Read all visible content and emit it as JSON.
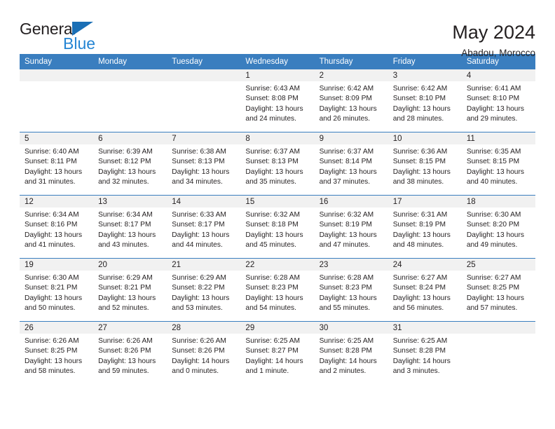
{
  "brand": {
    "name_part1": "General",
    "name_part2": "Blue",
    "accent_color": "#2585d3",
    "triangle_color": "#1b6fb5"
  },
  "header": {
    "title": "May 2024",
    "subtitle": "Abadou, Morocco"
  },
  "calendar": {
    "header_bg": "#3a7ebf",
    "daynum_bg": "#f1f1f1",
    "weekday_headers": [
      "Sunday",
      "Monday",
      "Tuesday",
      "Wednesday",
      "Thursday",
      "Friday",
      "Saturday"
    ],
    "weeks": [
      [
        {
          "day": "",
          "sunrise": "",
          "sunset": "",
          "daylight1": "",
          "daylight2": ""
        },
        {
          "day": "",
          "sunrise": "",
          "sunset": "",
          "daylight1": "",
          "daylight2": ""
        },
        {
          "day": "",
          "sunrise": "",
          "sunset": "",
          "daylight1": "",
          "daylight2": ""
        },
        {
          "day": "1",
          "sunrise": "Sunrise: 6:43 AM",
          "sunset": "Sunset: 8:08 PM",
          "daylight1": "Daylight: 13 hours",
          "daylight2": "and 24 minutes."
        },
        {
          "day": "2",
          "sunrise": "Sunrise: 6:42 AM",
          "sunset": "Sunset: 8:09 PM",
          "daylight1": "Daylight: 13 hours",
          "daylight2": "and 26 minutes."
        },
        {
          "day": "3",
          "sunrise": "Sunrise: 6:42 AM",
          "sunset": "Sunset: 8:10 PM",
          "daylight1": "Daylight: 13 hours",
          "daylight2": "and 28 minutes."
        },
        {
          "day": "4",
          "sunrise": "Sunrise: 6:41 AM",
          "sunset": "Sunset: 8:10 PM",
          "daylight1": "Daylight: 13 hours",
          "daylight2": "and 29 minutes."
        }
      ],
      [
        {
          "day": "5",
          "sunrise": "Sunrise: 6:40 AM",
          "sunset": "Sunset: 8:11 PM",
          "daylight1": "Daylight: 13 hours",
          "daylight2": "and 31 minutes."
        },
        {
          "day": "6",
          "sunrise": "Sunrise: 6:39 AM",
          "sunset": "Sunset: 8:12 PM",
          "daylight1": "Daylight: 13 hours",
          "daylight2": "and 32 minutes."
        },
        {
          "day": "7",
          "sunrise": "Sunrise: 6:38 AM",
          "sunset": "Sunset: 8:13 PM",
          "daylight1": "Daylight: 13 hours",
          "daylight2": "and 34 minutes."
        },
        {
          "day": "8",
          "sunrise": "Sunrise: 6:37 AM",
          "sunset": "Sunset: 8:13 PM",
          "daylight1": "Daylight: 13 hours",
          "daylight2": "and 35 minutes."
        },
        {
          "day": "9",
          "sunrise": "Sunrise: 6:37 AM",
          "sunset": "Sunset: 8:14 PM",
          "daylight1": "Daylight: 13 hours",
          "daylight2": "and 37 minutes."
        },
        {
          "day": "10",
          "sunrise": "Sunrise: 6:36 AM",
          "sunset": "Sunset: 8:15 PM",
          "daylight1": "Daylight: 13 hours",
          "daylight2": "and 38 minutes."
        },
        {
          "day": "11",
          "sunrise": "Sunrise: 6:35 AM",
          "sunset": "Sunset: 8:15 PM",
          "daylight1": "Daylight: 13 hours",
          "daylight2": "and 40 minutes."
        }
      ],
      [
        {
          "day": "12",
          "sunrise": "Sunrise: 6:34 AM",
          "sunset": "Sunset: 8:16 PM",
          "daylight1": "Daylight: 13 hours",
          "daylight2": "and 41 minutes."
        },
        {
          "day": "13",
          "sunrise": "Sunrise: 6:34 AM",
          "sunset": "Sunset: 8:17 PM",
          "daylight1": "Daylight: 13 hours",
          "daylight2": "and 43 minutes."
        },
        {
          "day": "14",
          "sunrise": "Sunrise: 6:33 AM",
          "sunset": "Sunset: 8:17 PM",
          "daylight1": "Daylight: 13 hours",
          "daylight2": "and 44 minutes."
        },
        {
          "day": "15",
          "sunrise": "Sunrise: 6:32 AM",
          "sunset": "Sunset: 8:18 PM",
          "daylight1": "Daylight: 13 hours",
          "daylight2": "and 45 minutes."
        },
        {
          "day": "16",
          "sunrise": "Sunrise: 6:32 AM",
          "sunset": "Sunset: 8:19 PM",
          "daylight1": "Daylight: 13 hours",
          "daylight2": "and 47 minutes."
        },
        {
          "day": "17",
          "sunrise": "Sunrise: 6:31 AM",
          "sunset": "Sunset: 8:19 PM",
          "daylight1": "Daylight: 13 hours",
          "daylight2": "and 48 minutes."
        },
        {
          "day": "18",
          "sunrise": "Sunrise: 6:30 AM",
          "sunset": "Sunset: 8:20 PM",
          "daylight1": "Daylight: 13 hours",
          "daylight2": "and 49 minutes."
        }
      ],
      [
        {
          "day": "19",
          "sunrise": "Sunrise: 6:30 AM",
          "sunset": "Sunset: 8:21 PM",
          "daylight1": "Daylight: 13 hours",
          "daylight2": "and 50 minutes."
        },
        {
          "day": "20",
          "sunrise": "Sunrise: 6:29 AM",
          "sunset": "Sunset: 8:21 PM",
          "daylight1": "Daylight: 13 hours",
          "daylight2": "and 52 minutes."
        },
        {
          "day": "21",
          "sunrise": "Sunrise: 6:29 AM",
          "sunset": "Sunset: 8:22 PM",
          "daylight1": "Daylight: 13 hours",
          "daylight2": "and 53 minutes."
        },
        {
          "day": "22",
          "sunrise": "Sunrise: 6:28 AM",
          "sunset": "Sunset: 8:23 PM",
          "daylight1": "Daylight: 13 hours",
          "daylight2": "and 54 minutes."
        },
        {
          "day": "23",
          "sunrise": "Sunrise: 6:28 AM",
          "sunset": "Sunset: 8:23 PM",
          "daylight1": "Daylight: 13 hours",
          "daylight2": "and 55 minutes."
        },
        {
          "day": "24",
          "sunrise": "Sunrise: 6:27 AM",
          "sunset": "Sunset: 8:24 PM",
          "daylight1": "Daylight: 13 hours",
          "daylight2": "and 56 minutes."
        },
        {
          "day": "25",
          "sunrise": "Sunrise: 6:27 AM",
          "sunset": "Sunset: 8:25 PM",
          "daylight1": "Daylight: 13 hours",
          "daylight2": "and 57 minutes."
        }
      ],
      [
        {
          "day": "26",
          "sunrise": "Sunrise: 6:26 AM",
          "sunset": "Sunset: 8:25 PM",
          "daylight1": "Daylight: 13 hours",
          "daylight2": "and 58 minutes."
        },
        {
          "day": "27",
          "sunrise": "Sunrise: 6:26 AM",
          "sunset": "Sunset: 8:26 PM",
          "daylight1": "Daylight: 13 hours",
          "daylight2": "and 59 minutes."
        },
        {
          "day": "28",
          "sunrise": "Sunrise: 6:26 AM",
          "sunset": "Sunset: 8:26 PM",
          "daylight1": "Daylight: 14 hours",
          "daylight2": "and 0 minutes."
        },
        {
          "day": "29",
          "sunrise": "Sunrise: 6:25 AM",
          "sunset": "Sunset: 8:27 PM",
          "daylight1": "Daylight: 14 hours",
          "daylight2": "and 1 minute."
        },
        {
          "day": "30",
          "sunrise": "Sunrise: 6:25 AM",
          "sunset": "Sunset: 8:28 PM",
          "daylight1": "Daylight: 14 hours",
          "daylight2": "and 2 minutes."
        },
        {
          "day": "31",
          "sunrise": "Sunrise: 6:25 AM",
          "sunset": "Sunset: 8:28 PM",
          "daylight1": "Daylight: 14 hours",
          "daylight2": "and 3 minutes."
        },
        {
          "day": "",
          "sunrise": "",
          "sunset": "",
          "daylight1": "",
          "daylight2": ""
        }
      ]
    ]
  }
}
